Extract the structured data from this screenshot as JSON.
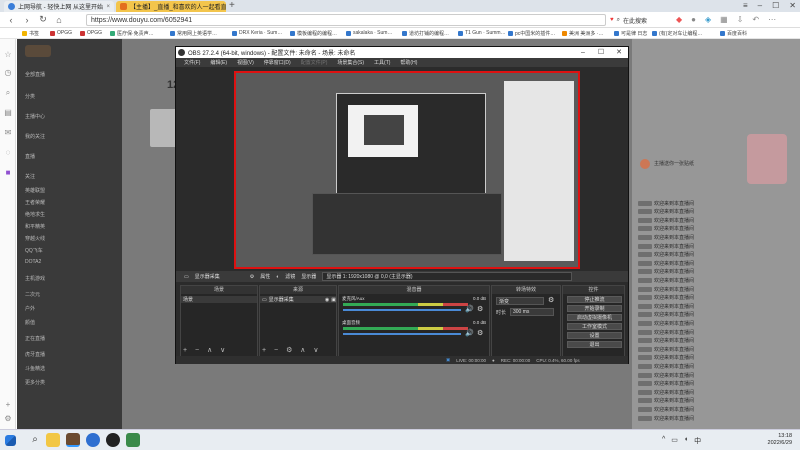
{
  "browser": {
    "tabs": [
      {
        "title": "上网导航 - 轻快上网 从这里开始",
        "active": false
      },
      {
        "title": "【主播】_直播_和喜欢的人一起看直播",
        "active": true
      }
    ],
    "new_tab": "+",
    "url": "https://www.douyu.com/6052941",
    "search_placeholder": "在此搜索",
    "bookmarks": [
      "书签",
      "OPGG",
      "OPGG",
      "医疗保·免责声…",
      "常用网上英语学…",
      "DRX Keria · Sum…",
      "模板编程的编程…",
      "sakalaka · Sum…",
      "道坊打铺的编程…",
      "T1 Gun · Summ…",
      "pc中国米的插件…",
      "美洲 美洲多 ·…",
      "可是律 日志",
      "(有)定对车让编程…",
      "百度百科"
    ]
  },
  "douyu": {
    "sidebar": [
      "全部直播",
      "分类",
      "主播中心",
      "我的关注",
      "直播",
      "关注",
      "英雄联盟",
      "王者荣耀",
      "绝地求生",
      "和平精英",
      "穿越火线",
      "QQ飞车",
      "DOTA2",
      "主机游戏",
      "二次元",
      "户外",
      "颜值",
      "正在直播",
      "虎牙直播",
      "斗鱼精选",
      "更多分类"
    ],
    "room_count": "12",
    "chat_banner": "主播送你一张贴纸",
    "chat_lines": [
      "欢迎来到本直播间",
      "欢迎来到本直播间",
      "欢迎来到本直播间",
      "欢迎来到本直播间",
      "欢迎来到本直播间",
      "欢迎来到本直播间",
      "欢迎来到本直播间",
      "欢迎来到本直播间",
      "欢迎来到本直播间",
      "欢迎来到本直播间",
      "欢迎来到本直播间",
      "欢迎来到本直播间",
      "欢迎来到本直播间",
      "欢迎来到本直播间",
      "欢迎来到本直播间",
      "欢迎来到本直播间",
      "欢迎来到本直播间",
      "欢迎来到本直播间",
      "欢迎来到本直播间",
      "欢迎来到本直播间",
      "欢迎来到本直播间",
      "欢迎来到本直播间",
      "欢迎来到本直播间",
      "欢迎来到本直播间",
      "欢迎来到本直播间",
      "欢迎来到本直播间"
    ]
  },
  "obs": {
    "title": "OBS 27.2.4 (64-bit, windows) - 配置文件: 未命名 - 场景: 未命名",
    "menu": [
      "文件(F)",
      "编辑(E)",
      "视图(V)",
      "停靠窗口(D)",
      "配置文件(P)",
      "场景集合(S)",
      "工具(T)",
      "帮助(H)"
    ],
    "toolbar": {
      "source": "显示器采集",
      "props": "属性",
      "filters": "滤镜",
      "display": "显示器",
      "display_value": "显示器 1: 1920x1080 @ 0,0 (主显示器)"
    },
    "docks": {
      "scenes": "场景",
      "sources": "来源",
      "mixer": "混音器",
      "transitions": "转场特效",
      "controls": "控件"
    },
    "scene_item": "场景",
    "source_item": "显示器采集",
    "mixer": [
      {
        "name": "麦克风/Aux",
        "db": "0.0 dB"
      },
      {
        "name": "桌面音频",
        "db": "0.0 dB"
      }
    ],
    "transition": {
      "type": "渐变",
      "duration_label": "时长",
      "duration": "300 ms"
    },
    "controls": [
      "停止推流",
      "开始录制",
      "启动虚拟摄像机",
      "工作室模式",
      "设置",
      "退出"
    ],
    "status": {
      "live": "LIVE: 00:00:00",
      "rec": "REC: 00:00:00",
      "cpu": "CPU: 0.4%, 60.00 fps"
    }
  },
  "taskbar": {
    "time": "13:18",
    "date": "2022/6/29"
  }
}
